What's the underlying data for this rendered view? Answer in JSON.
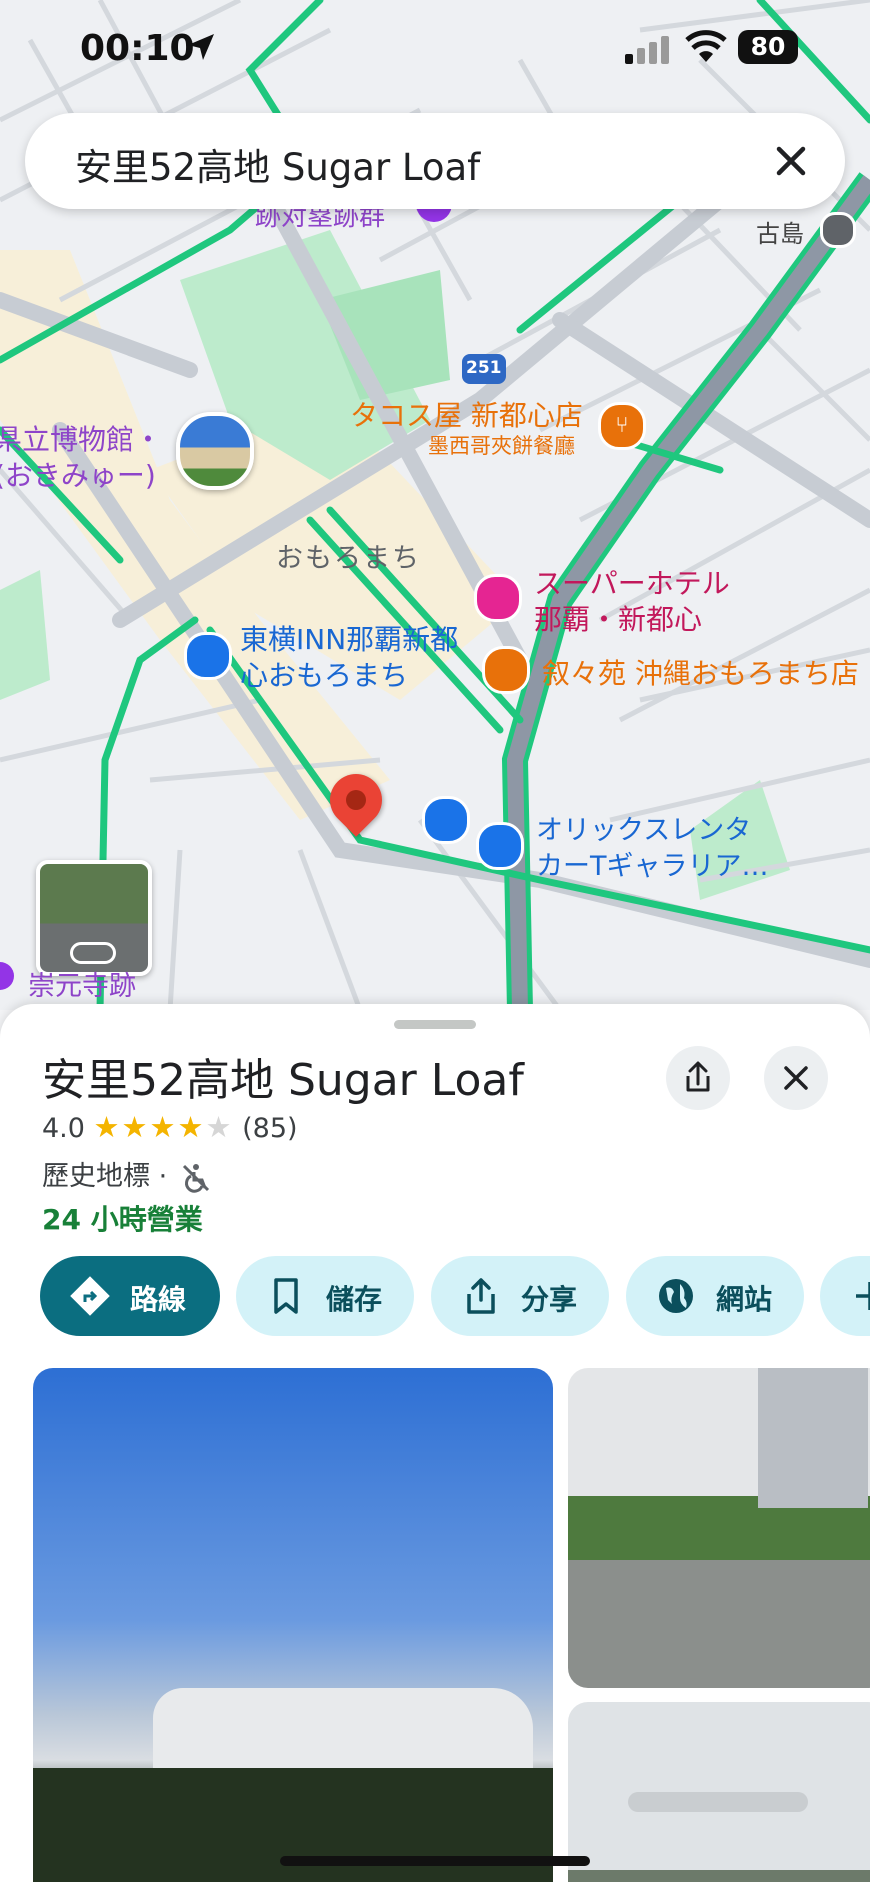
{
  "status_bar": {
    "time": "00:10",
    "battery": "80"
  },
  "search": {
    "query": "安里52高地 Sugar Loaf"
  },
  "map": {
    "labels": {
      "ruins_top": "跡对塁跡群",
      "furushima": "古島",
      "route": "251",
      "tacos_name": "タコス屋 新都心店",
      "tacos_sub": "墨西哥夾餅餐廳",
      "museum_line1": "県立博物館・",
      "museum_line2": "(おきみゅー)",
      "omoromachi": "おもろまち",
      "super_hotel_line1": "スーパーホテル",
      "super_hotel_line2": "那覇・新都心",
      "toyoko_line1": "東横INN那覇新都",
      "toyoko_line2": "心おもろまち",
      "joyen": "叙々苑 沖縄おもろまち店",
      "orix_line1": "オリックスレンタ",
      "orix_line2": "カーTギャラリア…",
      "temple": "崇元寺跡"
    }
  },
  "place": {
    "title": "安里52高地 Sugar Loaf",
    "rating": "4.0",
    "stars_filled": 4,
    "reviews": "(85)",
    "category": "歷史地標 ·",
    "hours": "24 小時營業",
    "actions": {
      "directions": "路線",
      "save": "儲存",
      "share": "分享",
      "website": "網站"
    }
  },
  "colors": {
    "accent": "#0b6e80",
    "pill_bg": "#d3f2f8",
    "open_green": "#188038",
    "map_green_road": "#1fc77e",
    "poi_orange": "#e8710a",
    "poi_purple": "#9334e6",
    "poi_blue": "#1a73e8",
    "pin_red": "#ea4335"
  }
}
